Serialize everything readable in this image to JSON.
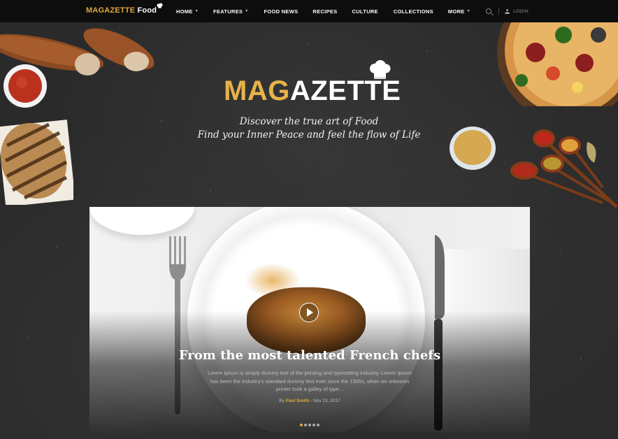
{
  "nav": {
    "logo_gold": "MAGAZETTE",
    "logo_white": "Food",
    "items": [
      {
        "label": "HOME",
        "has_dropdown": true
      },
      {
        "label": "FEATURES",
        "has_dropdown": true
      },
      {
        "label": "FOOD NEWS",
        "has_dropdown": false
      },
      {
        "label": "RECIPES",
        "has_dropdown": false
      },
      {
        "label": "CULTURE",
        "has_dropdown": false
      },
      {
        "label": "COLLECTIONS",
        "has_dropdown": false
      },
      {
        "label": "MORE",
        "has_dropdown": true
      }
    ],
    "login_label": "LOGIN"
  },
  "hero": {
    "brand_gold": "MAG",
    "brand_white": "AZETTE",
    "tagline_line1": "Discover the true art of Food",
    "tagline_line2": "Find your Inner Peace and feel the flow of Life"
  },
  "slider": {
    "title": "From the most talented French chefs",
    "excerpt": "Lorem Ipsum is simply dummy text of the printing and typesetting industry. Lorem Ipsum has been the industry's standard dummy text ever since the 1500s, when an unknown printer took a galley of type...",
    "by_label": "By",
    "author": "Paul Smith",
    "date_separator": "-",
    "date": "Nov 23, 2017",
    "slide_count": 5,
    "active_slide": 1
  },
  "colors": {
    "accent": "#e0a93c",
    "nav_bg": "#0d0d0d",
    "board_bg": "#2a2a2a"
  },
  "icons": [
    "chef-hat-icon",
    "search-icon",
    "user-icon",
    "play-icon",
    "caret-down-icon"
  ]
}
